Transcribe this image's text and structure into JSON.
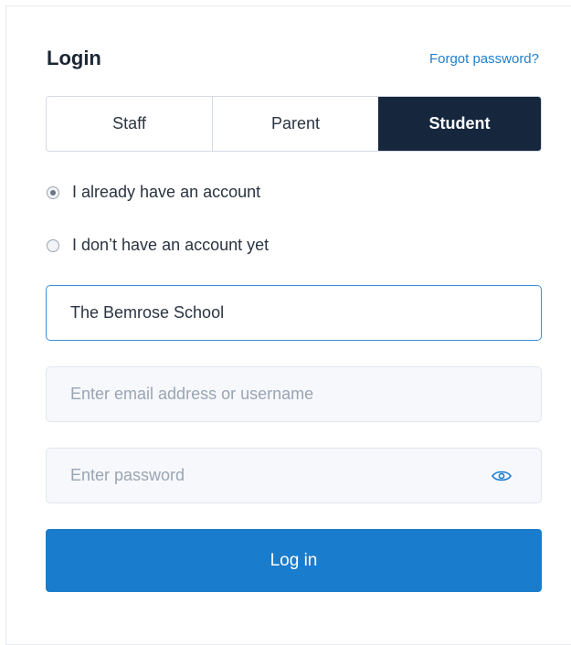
{
  "header": {
    "title": "Login",
    "forgot_password": "Forgot password?"
  },
  "role_tabs": [
    {
      "label": "Staff",
      "selected": false
    },
    {
      "label": "Parent",
      "selected": false
    },
    {
      "label": "Student",
      "selected": true
    }
  ],
  "account_options": [
    {
      "label": "I already have an account",
      "checked": true
    },
    {
      "label": "I don’t have an account yet",
      "checked": false
    }
  ],
  "form": {
    "school_value": "The Bemrose School",
    "email_placeholder": "Enter email address or username",
    "password_placeholder": "Enter password",
    "show_password_icon": "eye-icon",
    "submit_label": "Log in"
  },
  "colors": {
    "active_tab_bg": "#15263d",
    "primary_button": "#1a7ccc",
    "link": "#1f7fcf",
    "focused_border": "#3d8ed8"
  }
}
